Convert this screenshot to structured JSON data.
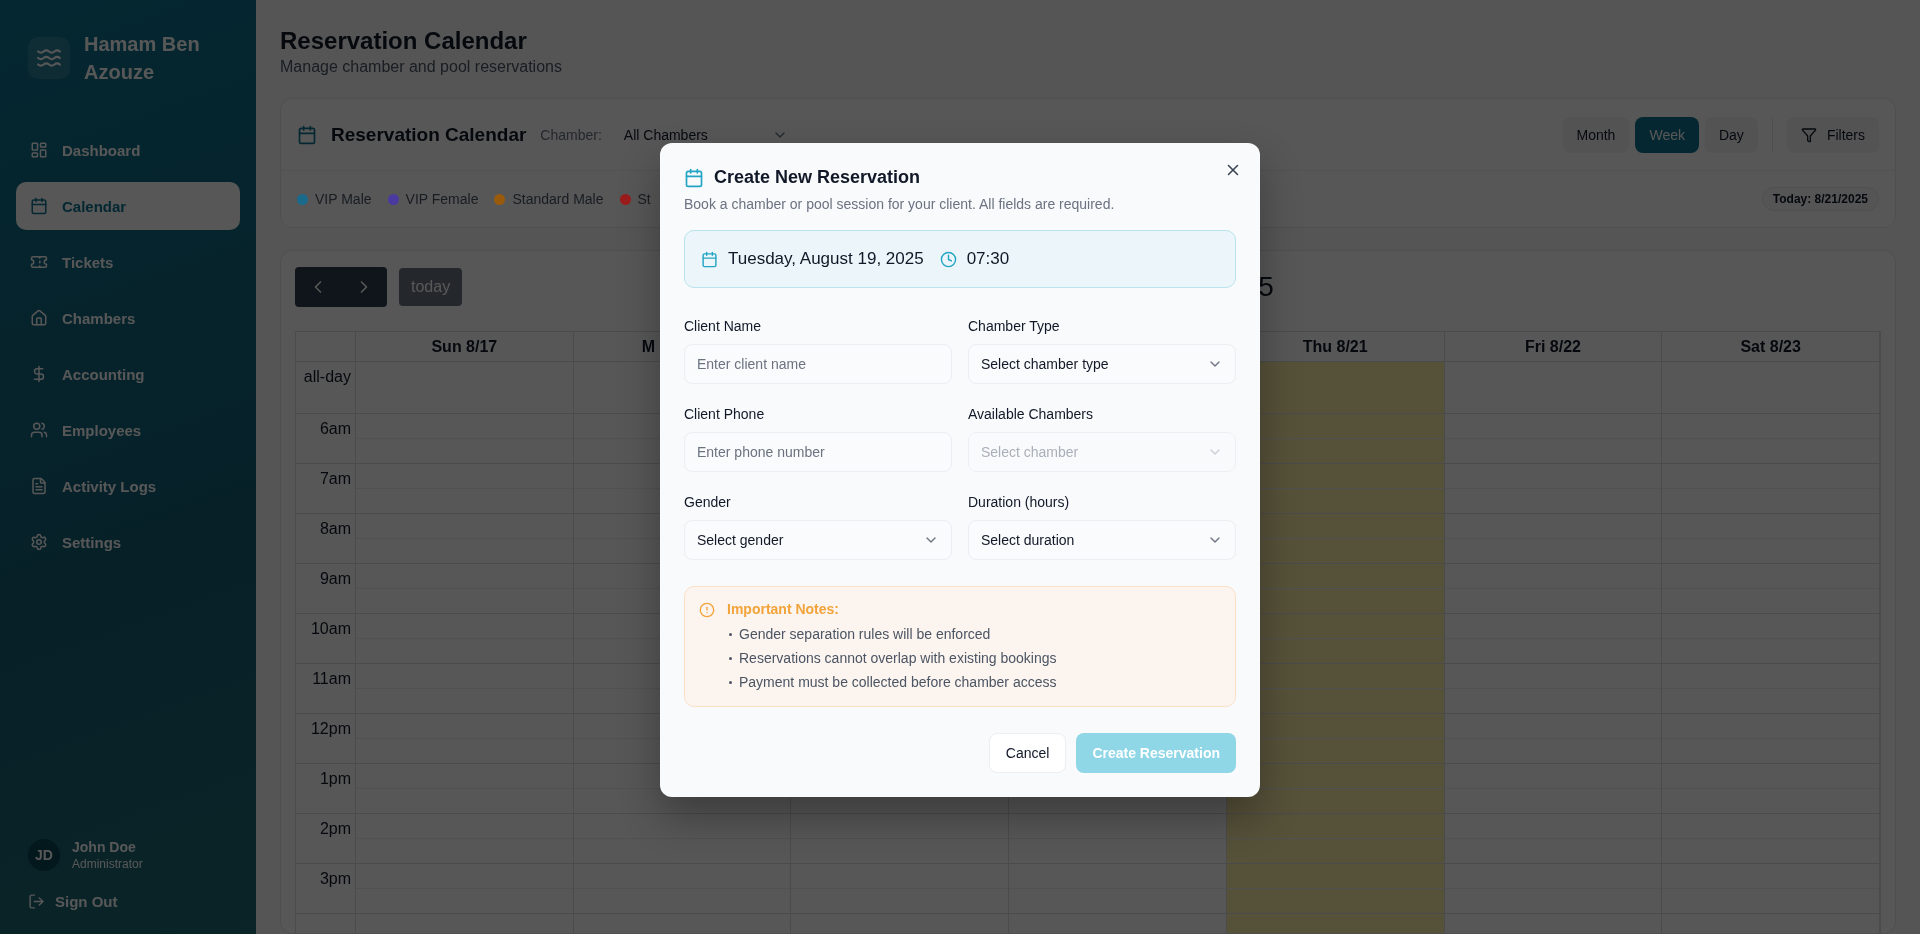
{
  "sidebar": {
    "brand": "Hamam Ben Azouze",
    "items": [
      {
        "label": "Dashboard",
        "selected": false
      },
      {
        "label": "Calendar",
        "selected": true
      },
      {
        "label": "Tickets",
        "selected": false
      },
      {
        "label": "Chambers",
        "selected": false
      },
      {
        "label": "Accounting",
        "selected": false
      },
      {
        "label": "Employees",
        "selected": false
      },
      {
        "label": "Activity Logs",
        "selected": false
      },
      {
        "label": "Settings",
        "selected": false
      }
    ],
    "user": {
      "initials": "JD",
      "name": "John Doe",
      "role": "Administrator"
    },
    "sign_out": "Sign Out"
  },
  "header": {
    "title": "Reservation Calendar",
    "subtitle": "Manage chamber and pool reservations"
  },
  "toolbar": {
    "title": "Reservation Calendar",
    "chamber_label": "Chamber:",
    "chamber_value": "All Chambers",
    "views": [
      {
        "label": "Month",
        "selected": false
      },
      {
        "label": "Week",
        "selected": true
      },
      {
        "label": "Day",
        "selected": false
      }
    ],
    "filters": "Filters",
    "legend": [
      {
        "label": "VIP Male",
        "color": "#1a6a8c"
      },
      {
        "label": "VIP Female",
        "color": "#4a3aa0"
      },
      {
        "label": "Standard Male",
        "color": "#9a5a0c"
      },
      {
        "label": "St",
        "color": "#9c1c1c"
      }
    ],
    "today_badge": "Today: 8/21/2025"
  },
  "calendar": {
    "today_button": "today",
    "title": "5",
    "all_day": "all-day",
    "columns": [
      {
        "label": "Sun 8/17",
        "today": false
      },
      {
        "label": "M",
        "today": false,
        "clipped": true
      },
      {
        "today": false
      },
      {
        "today": false
      },
      {
        "label": "Thu 8/21",
        "today": true
      },
      {
        "label": "Fri 8/22",
        "today": false
      },
      {
        "label": "Sat 8/23",
        "today": false
      }
    ],
    "hours": [
      "6am",
      "7am",
      "8am",
      "9am",
      "10am",
      "11am",
      "12pm",
      "1pm",
      "2pm",
      "3pm"
    ]
  },
  "dialog": {
    "title": "Create New Reservation",
    "description": "Book a chamber or pool session for your client. All fields are required.",
    "date": "Tuesday, August 19, 2025",
    "time": "07:30",
    "fields": [
      {
        "label": "Client Name",
        "kind": "input",
        "placeholder": "Enter client name"
      },
      {
        "label": "Chamber Type",
        "kind": "select",
        "value": "Select chamber type",
        "disabled": false
      },
      {
        "label": "Client Phone",
        "kind": "input",
        "placeholder": "Enter phone number"
      },
      {
        "label": "Available Chambers",
        "kind": "select",
        "placeholder": "Select chamber",
        "disabled": true
      },
      {
        "label": "Gender",
        "kind": "select",
        "value": "Select gender",
        "disabled": false
      },
      {
        "label": "Duration (hours)",
        "kind": "select",
        "value": "Select duration",
        "disabled": false
      }
    ],
    "notes": {
      "title": "Important Notes:",
      "items": [
        "Gender separation rules will be enforced",
        "Reservations cannot overlap with existing bookings",
        "Payment must be collected before chamber access"
      ]
    },
    "cancel": "Cancel",
    "submit": {
      "label": "Create Reservation",
      "disabled": true
    }
  }
}
